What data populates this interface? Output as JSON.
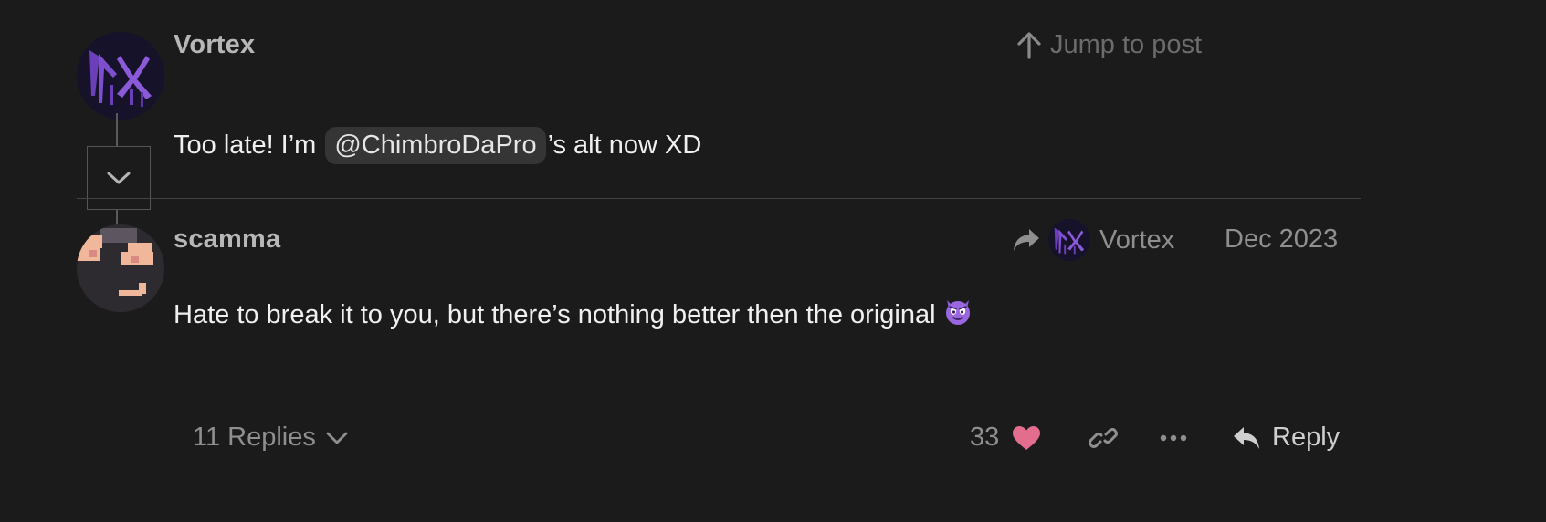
{
  "post1": {
    "username": "Vortex",
    "jump_label": "Jump to post",
    "text_before": "Too late! I’m",
    "mention": "@ChimbroDaPro",
    "text_after": "’s alt now XD"
  },
  "post2": {
    "username": "scamma",
    "reply_to_username": "Vortex",
    "date": "Dec 2023",
    "text": "Hate to break it to you, but there’s nothing better then the original",
    "emoji": "smiling-imp-emoji"
  },
  "actions": {
    "replies_label": "11 Replies",
    "like_count": "33",
    "reply_label": "Reply"
  },
  "colors": {
    "background": "#1b1b1b",
    "heart": "#e26d8c",
    "mention_bg": "#353535"
  },
  "icons": [
    "arrow-up-icon",
    "chevron-down-icon",
    "share-reply-icon",
    "heart-icon",
    "link-icon",
    "more-icon",
    "reply-icon"
  ]
}
